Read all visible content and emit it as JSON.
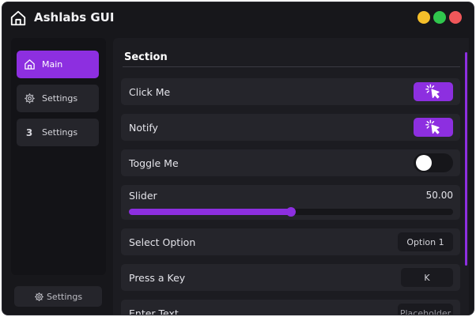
{
  "app": {
    "title": "Ashlabs GUI"
  },
  "window_controls": {
    "minimize": "#f5bf2a",
    "maximize": "#30c64d",
    "close": "#f0575a"
  },
  "theme": {
    "accent": "#8d2fe0",
    "background": "#17171b",
    "panel": "#25252b"
  },
  "sidebar": {
    "items": [
      {
        "label": "Main",
        "icon": "home-icon",
        "active": true
      },
      {
        "label": "Settings",
        "icon": "gear-icon",
        "active": false
      },
      {
        "label": "Settings",
        "icon_text": "3",
        "active": false
      }
    ],
    "footer_label": "Settings"
  },
  "main": {
    "section_title": "Section",
    "controls": {
      "click_me": {
        "label": "Click Me",
        "icon": "pointer-click-icon"
      },
      "notify": {
        "label": "Notify",
        "icon": "pointer-click-icon"
      },
      "toggle": {
        "label": "Toggle Me",
        "on": false
      },
      "slider": {
        "label": "Slider",
        "value_text": "50.00",
        "fraction": 0.5
      },
      "select": {
        "label": "Select Option",
        "value": "Option 1"
      },
      "keybind": {
        "label": "Press a Key",
        "value": "K"
      },
      "text_input": {
        "label": "Enter Text",
        "placeholder": "Placeholder"
      }
    }
  }
}
